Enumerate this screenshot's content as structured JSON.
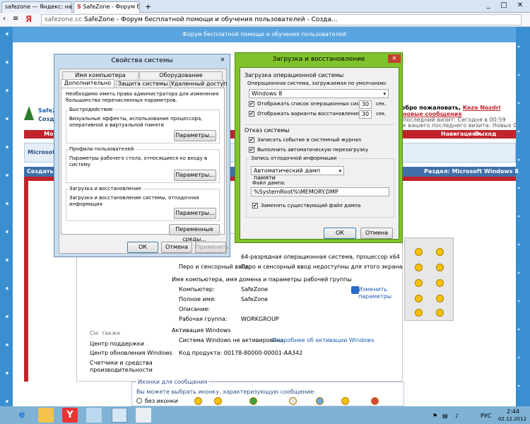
{
  "browser": {
    "tabs": [
      {
        "label": "safezone — Яндекс: нашлось"
      },
      {
        "label": "SafeZone - Форум бесп"
      }
    ],
    "new_tab_symbol": "+",
    "address": "safezone.cc",
    "title": "SafeZone - Форум бесплатной помощи и обучения пользователей - Созда...",
    "yandex_glyph": "Я",
    "window_controls": [
      "_",
      "□",
      "✕"
    ]
  },
  "site": {
    "banner_text": "Форум бесплатной помощи и обучения пользователей",
    "logo_text": [
      "SafeZ",
      "Созд"
    ],
    "welcome": "обро пожаловать, ",
    "username": "Koza Nozdri",
    "new_messages": "новые сообщения",
    "last_visit": "последний визит: Сегодня в 00:59",
    "since": "к вашего последнего визита: Новых 0, всего 41.",
    "nav_left": "Мой каб",
    "nav_nav": "Навигация ▾",
    "nav_exit": "Выход",
    "microsoft_label": "Microsoft",
    "create_label": "Создать",
    "section_label": "Раздел: Microsoft Windows 8",
    "icons_title": "Иконки для сообщения",
    "icons_hint": "Вы можете выбрать иконку, характеризующую сообщение:",
    "no_icon": "без иконки"
  },
  "sysinfo": {
    "arch_label": "64-разрядная операционная система, процессор x64",
    "pen_label": "Перо и сенсорный ввод:",
    "pen_value": "Перо и сенсорный ввод недоступны для этого экрана",
    "name_section": "Имя компьютера, имя домена и параметры рабочей группы",
    "change_params": "Изменить параметры",
    "rows": [
      {
        "label": "Компьютер:",
        "value": "SafeZone"
      },
      {
        "label": "Полное имя:",
        "value": "SafeZone"
      },
      {
        "label": "Описание:",
        "value": ""
      },
      {
        "label": "Рабочая группа:",
        "value": "WORKGROUP"
      }
    ],
    "see_also": "См. также",
    "links": [
      "Центр поддержки",
      "Центр обновления Windows",
      "Счетчики и средства производительности"
    ],
    "activation_title": "Активация Windows",
    "activation_status": "Система Windows не активирована.",
    "activation_link": "Подробнее об активации Windows",
    "product_code": "Код продукта: 00178-80000-00001-AA342"
  },
  "sysprops": {
    "title": "Свойства системы",
    "tabs_row1": [
      "Имя компьютера",
      "Оборудование"
    ],
    "tabs_row2": [
      "Дополнительно",
      "Защита системы",
      "Удаленный доступ"
    ],
    "admin_note": "Необходимо иметь права администратора для изменения большинства перечисленных параметров.",
    "groups": [
      {
        "title": "Быстродействие",
        "desc": "Визуальные эффекты, использование процессора, оперативной и виртуальной памяти",
        "button": "Параметры..."
      },
      {
        "title": "Профили пользователей",
        "desc": "Параметры рабочего стола, относящиеся ко входу в систему",
        "button": "Параметры..."
      },
      {
        "title": "Загрузка и восстановление",
        "desc": "Загрузка и восстановление системы, отладочная информация",
        "button": "Параметры..."
      }
    ],
    "env_button": "Переменные среды...",
    "ok": "ОК",
    "cancel": "Отмена",
    "apply": "Применить",
    "close_symbol": "✕"
  },
  "boot": {
    "title": "Загрузка и восстановление",
    "close_symbol": "✕",
    "os_group": "Загрузка операционной системы",
    "default_os_label": "Операционная система, загружаемая по умолчанию:",
    "default_os": "Windows 8",
    "show_list": "Отображать список операционных систем:",
    "show_list_value": "30",
    "show_recovery": "Отображать варианты восстановления:",
    "show_recovery_value": "30",
    "sec": "сек.",
    "failure_group": "Отказ системы",
    "write_event": "Записать событие в системный журнал",
    "auto_restart": "Выполнить автоматическую перезагрузку",
    "debug_label": "Запись отладочной информации",
    "debug_value": "Автоматический дамп памяти",
    "dump_file_label": "Файл дампа:",
    "dump_file": "%SystemRoot%\\MEMORY.DMP",
    "overwrite": "Заменять существующий файл дампа",
    "ok": "ОК",
    "cancel": "Отмена",
    "check_symbol": "✔"
  },
  "taskbar": {
    "lang": "РУС",
    "time": "2:44",
    "date": "02.12.2012"
  },
  "colors": {
    "page_bg": "#3a8fd0",
    "red_bar": "#c0242a",
    "green_frame": "#80c32c",
    "link": "#1a5db0"
  }
}
